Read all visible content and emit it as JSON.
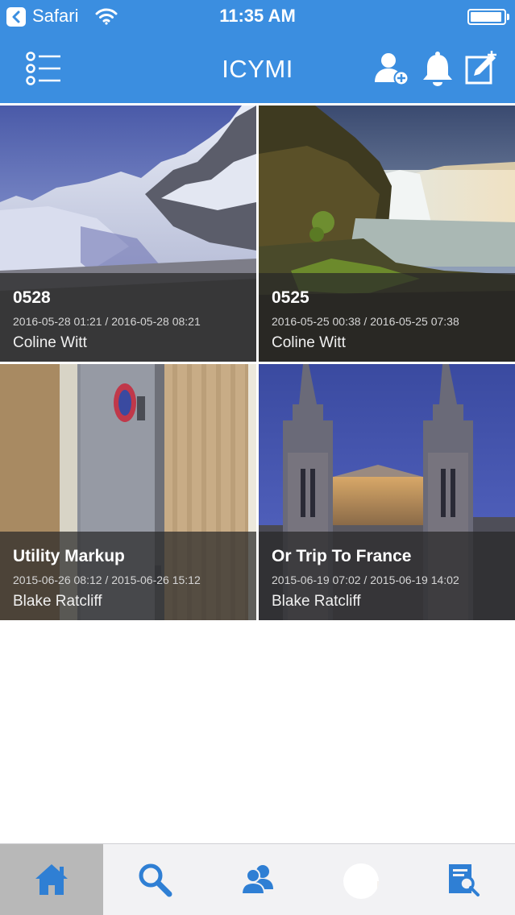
{
  "status_bar": {
    "back_app": "Safari",
    "time": "11:35 AM",
    "battery_level": 0.95
  },
  "nav": {
    "title": "ICYMI",
    "icons": [
      "menu-list-icon",
      "add-user-icon",
      "bell-icon",
      "compose-icon"
    ]
  },
  "albums": [
    {
      "title": "0528",
      "dates": "2016-05-28 01:21 / 2016-05-28 08:21",
      "author": "Coline Witt",
      "photo": "snowy-mountain"
    },
    {
      "title": "0525",
      "dates": "2016-05-25 00:38 / 2016-05-25 07:38",
      "author": "Coline Witt",
      "photo": "waterfall"
    },
    {
      "title": "Utility Markup",
      "dates": "2015-06-26 08:12 / 2015-06-26 15:12",
      "author": "Blake Ratcliff",
      "photo": "room-door"
    },
    {
      "title": "Or Trip To France",
      "dates": "2015-06-19 07:02 / 2015-06-19 14:02",
      "author": "Blake Ratcliff",
      "photo": "cathedral"
    }
  ],
  "tab_bar": {
    "active": "home",
    "tabs": [
      "home-icon",
      "search-icon",
      "friends-icon",
      "profile-avatar",
      "reader-icon"
    ]
  },
  "colors": {
    "brand_blue": "#3b8ee0",
    "tab_icon_blue": "#2f7fd4",
    "overlay": "#282828"
  }
}
